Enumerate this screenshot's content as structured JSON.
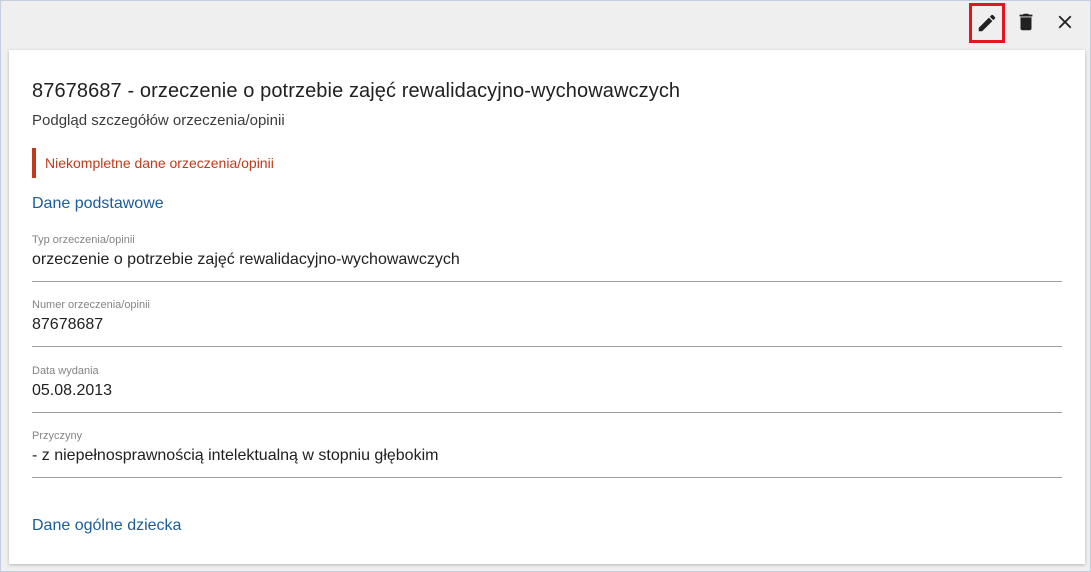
{
  "toolbar": {
    "edit_icon": "pencil-icon",
    "delete_icon": "trash-icon",
    "close_icon": "close-icon",
    "highlight_color": "#e8141b"
  },
  "header": {
    "title": "87678687 - orzeczenie o potrzebie zajęć rewalidacyjno-wychowawczych",
    "subtitle": "Podgląd szczegółów orzeczenia/opinii"
  },
  "warning": {
    "text": "Niekompletne dane orzeczenia/opinii",
    "color": "#c0391b"
  },
  "sections": {
    "basic_data_link": "Dane podstawowe",
    "child_data_link": "Dane ogólne dziecka",
    "link_color": "#1b5c9a"
  },
  "fields": [
    {
      "label": "Typ orzeczenia/opinii",
      "value": "orzeczenie o potrzebie zajęć rewalidacyjno-wychowawczych"
    },
    {
      "label": "Numer orzeczenia/opinii",
      "value": "87678687"
    },
    {
      "label": "Data wydania",
      "value": "05.08.2013"
    },
    {
      "label": "Przyczyny",
      "value": "- z niepełnosprawnością intelektualną w stopniu głębokim"
    }
  ]
}
